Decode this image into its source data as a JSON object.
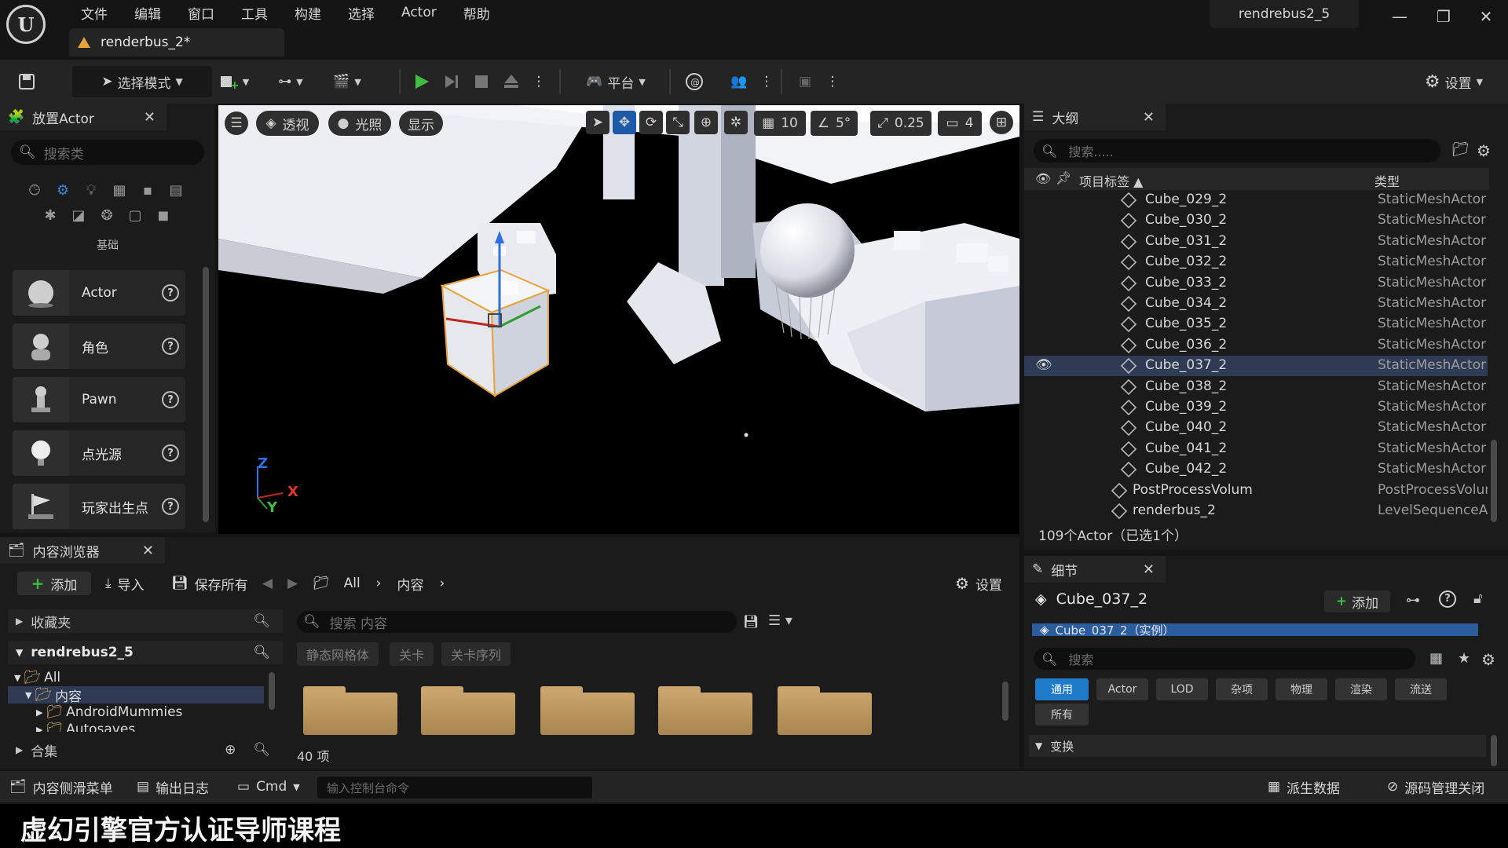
{
  "app": {
    "menu": [
      "文件",
      "编辑",
      "窗口",
      "工具",
      "构建",
      "选择",
      "Actor",
      "帮助"
    ],
    "doc_tab": "renderbus_2*",
    "project": "rendrebus2_5",
    "window_controls": [
      "minimize-icon",
      "restore-icon",
      "close-icon"
    ]
  },
  "toolbar": {
    "select_mode": "选择模式",
    "platform": "平台",
    "settings": "设置"
  },
  "place_actor": {
    "title": "放置Actor",
    "search_placeholder": "搜索类",
    "category_label": "基础",
    "items": [
      {
        "label": "Actor",
        "icon": "sphere-icon"
      },
      {
        "label": "角色",
        "icon": "character-icon"
      },
      {
        "label": "Pawn",
        "icon": "pawn-icon"
      },
      {
        "label": "点光源",
        "icon": "bulb-icon"
      },
      {
        "label": "玩家出生点",
        "icon": "flag-icon"
      }
    ]
  },
  "viewport": {
    "perspective": "透视",
    "lighting": "光照",
    "show": "显示",
    "grid_snap": "10",
    "rotation_snap": "5°",
    "scale_snap": "0.25",
    "camera_speed": "4",
    "axis_z": "Z",
    "axis_x": "X",
    "axis_y": "Y"
  },
  "outliner": {
    "title": "大纲",
    "search_placeholder": "搜索.....",
    "col_label": "项目标签",
    "col_type": "类型",
    "rows": [
      {
        "name": "Cube_029_2",
        "type": "StaticMeshActor"
      },
      {
        "name": "Cube_030_2",
        "type": "StaticMeshActor"
      },
      {
        "name": "Cube_031_2",
        "type": "StaticMeshActor"
      },
      {
        "name": "Cube_032_2",
        "type": "StaticMeshActor"
      },
      {
        "name": "Cube_033_2",
        "type": "StaticMeshActor"
      },
      {
        "name": "Cube_034_2",
        "type": "StaticMeshActor"
      },
      {
        "name": "Cube_035_2",
        "type": "StaticMeshActor"
      },
      {
        "name": "Cube_036_2",
        "type": "StaticMeshActor"
      },
      {
        "name": "Cube_037_2",
        "type": "StaticMeshActor"
      },
      {
        "name": "Cube_038_2",
        "type": "StaticMeshActor"
      },
      {
        "name": "Cube_039_2",
        "type": "StaticMeshActor"
      },
      {
        "name": "Cube_040_2",
        "type": "StaticMeshActor"
      },
      {
        "name": "Cube_041_2",
        "type": "StaticMeshActor"
      },
      {
        "name": "Cube_042_2",
        "type": "StaticMeshActor"
      },
      {
        "name": "PostProcessVolum",
        "type": "PostProcessVolum"
      },
      {
        "name": "renderbus_2",
        "type": "LevelSequenceAct"
      }
    ],
    "count": "109个Actor（已选1个）"
  },
  "details": {
    "title": "细节",
    "object": "Cube_037_2",
    "add": "添加",
    "instance": "Cube_037_2（实例）",
    "search_placeholder": "搜索",
    "tabs": [
      "通用",
      "Actor",
      "LOD",
      "杂项",
      "物理",
      "渲染",
      "流送"
    ],
    "tab_all": "所有",
    "section": "变换"
  },
  "content": {
    "title": "内容浏览器",
    "add": "添加",
    "import": "导入",
    "save_all": "保存所有",
    "path": [
      "All",
      "内容"
    ],
    "settings": "设置",
    "favorites": "收藏夹",
    "project": "rendrebus2_5",
    "tree": [
      "All",
      "内容",
      "AndroidMummies",
      "Autosaves"
    ],
    "collections": "合集",
    "search_placeholder": "搜索 内容",
    "filters": [
      "静态网格体",
      "关卡",
      "关卡序列"
    ],
    "item_count": "40 项"
  },
  "statusbar": {
    "drawer": "内容侧滑菜单",
    "output_log": "输出日志",
    "cmd": "Cmd",
    "cmd_placeholder": "输入控制台命令",
    "derived_data": "派生数据",
    "source_control": "源码管理关闭"
  },
  "watermark": "虚幻引擎官方认证导师课程",
  "colors": {
    "accent": "#1f7ac9",
    "play": "#3fbf3f",
    "selected_row": "#2f3b54",
    "background": "#1b1b1b"
  }
}
